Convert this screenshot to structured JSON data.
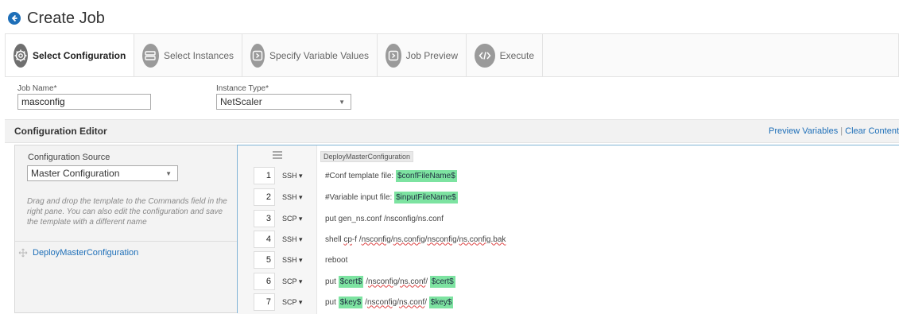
{
  "page": {
    "title": "Create Job"
  },
  "wizard": {
    "steps": [
      {
        "label": "Select Configuration",
        "icon": "gear-icon"
      },
      {
        "label": "Select Instances",
        "icon": "instances-icon"
      },
      {
        "label": "Specify Variable Values",
        "icon": "variables-icon"
      },
      {
        "label": "Job Preview",
        "icon": "preview-icon"
      },
      {
        "label": "Execute",
        "icon": "code-icon"
      }
    ]
  },
  "form": {
    "job_name_label": "Job Name*",
    "job_name_value": "masconfig",
    "instance_type_label": "Instance Type*",
    "instance_type_value": "NetScaler"
  },
  "editor": {
    "title": "Configuration Editor",
    "preview_variables": "Preview Variables",
    "separator": "|",
    "clear_content": "Clear Content",
    "source_label": "Configuration Source",
    "source_value": "Master Configuration",
    "help_text": "Drag and drop the template to the Commands field in the right pane. You can also edit the configuration and save the template with a different name",
    "template_item": "DeployMasterConfiguration",
    "file_tag": "DeployMasterConfiguration"
  },
  "commands": [
    {
      "num": "1",
      "proto": "SSH",
      "parts": [
        {
          "t": "#Conf template file: "
        },
        {
          "t": "$confFileName$",
          "v": true
        }
      ]
    },
    {
      "num": "2",
      "proto": "SSH",
      "parts": [
        {
          "t": "#Variable input file: "
        },
        {
          "t": "$inputFileName$",
          "v": true
        }
      ]
    },
    {
      "num": "3",
      "proto": "SCP",
      "parts": [
        {
          "t": "put gen_ns.conf /nsconfig/ns.conf"
        }
      ]
    },
    {
      "num": "4",
      "proto": "SSH",
      "parts": [
        {
          "t": "shell "
        },
        {
          "t": "cp",
          "s": true
        },
        {
          "t": "-f /"
        },
        {
          "t": "nsconfig",
          "s": true
        },
        {
          "t": "/"
        },
        {
          "t": "ns.config",
          "s": true
        },
        {
          "t": "/"
        },
        {
          "t": "nsconfig",
          "s": true
        },
        {
          "t": "/"
        },
        {
          "t": "ns.config.bak",
          "s": true
        }
      ]
    },
    {
      "num": "5",
      "proto": "SSH",
      "parts": [
        {
          "t": "reboot"
        }
      ]
    },
    {
      "num": "6",
      "proto": "SCP",
      "parts": [
        {
          "t": "put "
        },
        {
          "t": "$cert$",
          "v": true
        },
        {
          "t": " /"
        },
        {
          "t": "nsconfig",
          "s": true
        },
        {
          "t": "/"
        },
        {
          "t": "ns.conf",
          "s": true
        },
        {
          "t": "/ "
        },
        {
          "t": "$cert$",
          "v": true
        }
      ]
    },
    {
      "num": "7",
      "proto": "SCP",
      "parts": [
        {
          "t": "put "
        },
        {
          "t": "$key$",
          "v": true
        },
        {
          "t": " /"
        },
        {
          "t": "nsconfig",
          "s": true
        },
        {
          "t": "/"
        },
        {
          "t": "ns.conf",
          "s": true
        },
        {
          "t": "/ "
        },
        {
          "t": "$key$",
          "v": true
        }
      ]
    }
  ],
  "colors": {
    "accent": "#1e6fb8",
    "variable_highlight": "#7de3a1",
    "editor_border": "#7fb3d5"
  }
}
